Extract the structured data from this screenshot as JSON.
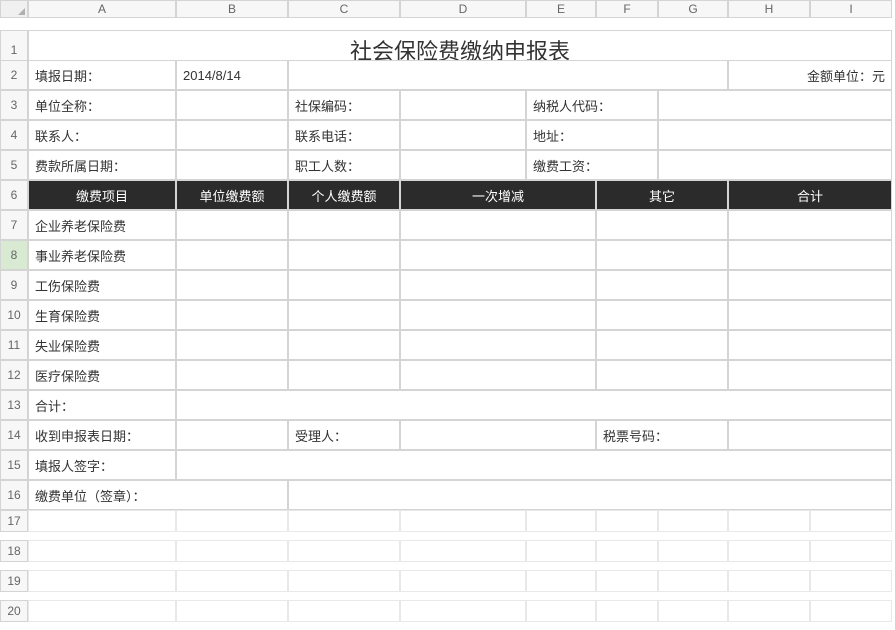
{
  "columns": [
    "A",
    "B",
    "C",
    "D",
    "E",
    "F",
    "G",
    "H",
    "I"
  ],
  "rows": [
    "1",
    "2",
    "3",
    "4",
    "5",
    "6",
    "7",
    "8",
    "9",
    "10",
    "11",
    "12",
    "13",
    "14",
    "15",
    "16",
    "17",
    "18",
    "19",
    "20"
  ],
  "selectedRow": 8,
  "title": "社会保险费缴纳申报表",
  "meta": {
    "fillDateLabel": "填报日期：",
    "fillDate": "2014/8/14",
    "unitLabel": "金额单位：元",
    "companyNameLabel": "单位全称：",
    "socialCodeLabel": "社保编码：",
    "taxCodeLabel": "纳税人代码：",
    "contactLabel": "联系人：",
    "phoneLabel": "联系电话：",
    "addressLabel": "地址：",
    "feePeriodLabel": "费款所属日期：",
    "employeeCountLabel": "职工人数：",
    "paySalaryLabel": "缴费工资："
  },
  "tableHeader": {
    "item": "缴费项目",
    "unitPay": "单位缴费额",
    "personalPay": "个人缴费额",
    "onceChange": "一次增减",
    "other": "其它",
    "total": "合计"
  },
  "items": [
    "企业养老保险费",
    "事业养老保险费",
    "工伤保险费",
    "生育保险费",
    "失业保险费",
    "医疗保险费"
  ],
  "totalLabel": "合计：",
  "footer": {
    "receiveDateLabel": "收到申报表日期：",
    "handlerLabel": "受理人：",
    "taxTicketLabel": "税票号码：",
    "fillerSignLabel": "填报人签字：",
    "companySealLabel": "缴费单位（签章）："
  }
}
